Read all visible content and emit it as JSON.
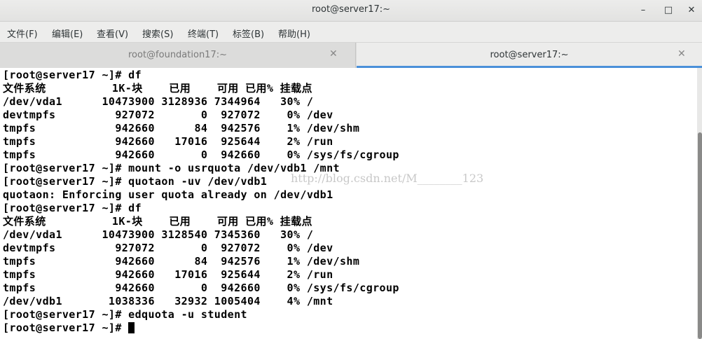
{
  "window": {
    "title": "root@server17:~"
  },
  "window_controls": {
    "minimize": "–",
    "maximize": "□",
    "close": "✕"
  },
  "menu": [
    "文件(F)",
    "编辑(E)",
    "查看(V)",
    "搜索(S)",
    "终端(T)",
    "标签(B)",
    "帮助(H)"
  ],
  "tabs": [
    {
      "label": "root@foundation17:~",
      "close": "✕",
      "active": false
    },
    {
      "label": "root@server17:~",
      "close": "✕",
      "active": true
    }
  ],
  "terminal": {
    "lines": [
      "[root@server17 ~]# df",
      "文件系统          1K-块    已用    可用 已用% 挂载点",
      "/dev/vda1      10473900 3128936 7344964   30% /",
      "devtmpfs         927072       0  927072    0% /dev",
      "tmpfs            942660      84  942576    1% /dev/shm",
      "tmpfs            942660   17016  925644    2% /run",
      "tmpfs            942660       0  942660    0% /sys/fs/cgroup",
      "[root@server17 ~]# mount -o usrquota /dev/vdb1 /mnt",
      "[root@server17 ~]# quotaon -uv /dev/vdb1",
      "quotaon: Enforcing user quota already on /dev/vdb1",
      "[root@server17 ~]# df",
      "文件系统          1K-块    已用    可用 已用% 挂载点",
      "/dev/vda1      10473900 3128540 7345360   30% /",
      "devtmpfs         927072       0  927072    0% /dev",
      "tmpfs            942660      84  942576    1% /dev/shm",
      "tmpfs            942660   17016  925644    2% /run",
      "tmpfs            942660       0  942660    0% /sys/fs/cgroup",
      "/dev/vdb1       1038336   32932 1005404    4% /mnt",
      "[root@server17 ~]# edquota -u student",
      "[root@server17 ~]# "
    ],
    "watermark": "http://blog.csdn.net/M________123"
  }
}
